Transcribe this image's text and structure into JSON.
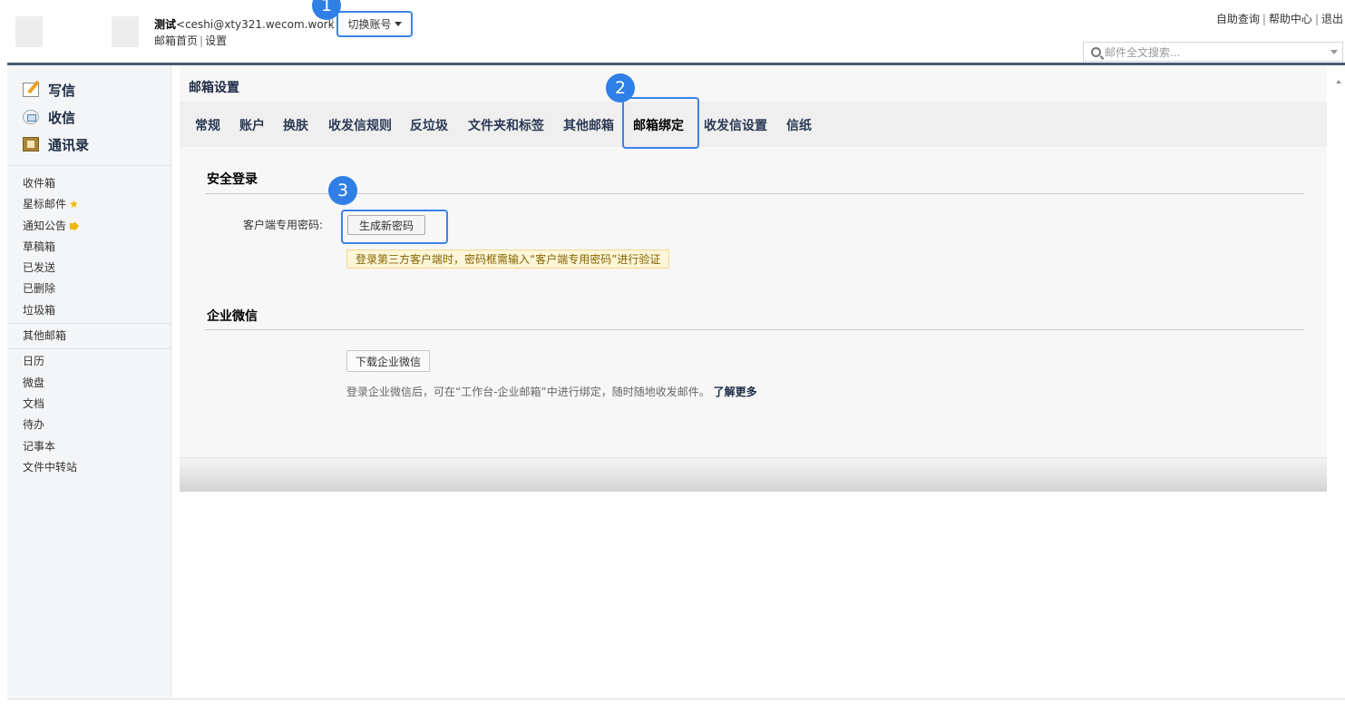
{
  "header": {
    "user_name": "测试",
    "user_email": "<ceshi@xty321.wecom.work>",
    "links": {
      "home": "邮箱首页",
      "settings": "设置"
    },
    "switch_account": "切换账号",
    "top_links": {
      "self_query": "自助查询",
      "help": "帮助中心",
      "logout": "退出"
    },
    "search_placeholder": "邮件全文搜索..."
  },
  "sidebar": {
    "actions": {
      "write": "写信",
      "receive": "收信",
      "contacts": "通讯录"
    },
    "folders": [
      "收件箱",
      "星标邮件",
      "通知公告",
      "草稿箱",
      "已发送",
      "已删除",
      "垃圾箱"
    ],
    "other": "其他邮箱",
    "apps": [
      "日历",
      "微盘",
      "文档",
      "待办",
      "记事本",
      "文件中转站"
    ]
  },
  "main": {
    "title": "邮箱设置",
    "tabs": [
      "常规",
      "账户",
      "换肤",
      "收发信规则",
      "反垃圾",
      "文件夹和标签",
      "其他邮箱",
      "邮箱绑定",
      "收发信设置",
      "信纸"
    ],
    "active_tab": "邮箱绑定",
    "security": {
      "title": "安全登录",
      "label": "客户端专用密码:",
      "button": "生成新密码",
      "tip": "登录第三方客户端时，密码框需输入“客户端专用密码”进行验证"
    },
    "wecom": {
      "title": "企业微信",
      "button": "下载企业微信",
      "desc": "登录企业微信后，可在“工作台-企业邮箱”中进行绑定，随时随地收发邮件。",
      "more": "了解更多"
    }
  },
  "badges": [
    "1",
    "2",
    "3"
  ],
  "colors": {
    "accent": "#3c82e6",
    "badge": "#2f7fe6",
    "header_rule": "#4a5a73",
    "tip_bg": "#fdf6d8"
  }
}
